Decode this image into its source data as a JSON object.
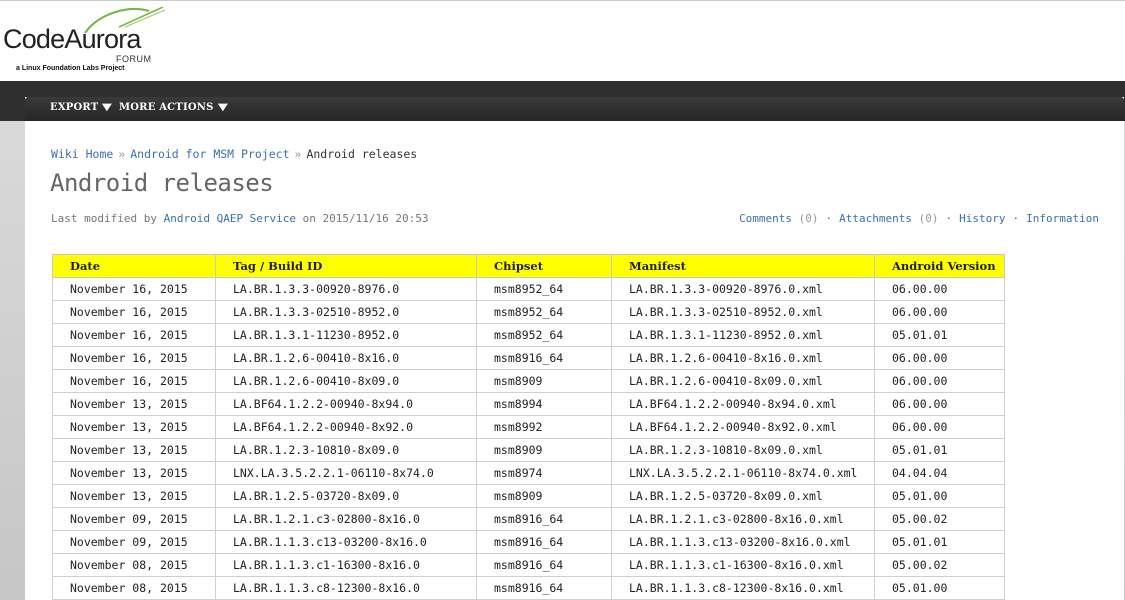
{
  "logo": {
    "code": "Code",
    "aurora": "Aurora",
    "forum": "FORUM",
    "tagline": "a Linux Foundation Labs Project"
  },
  "toolbar": {
    "export_label": "EXPORT",
    "more_actions_label": "MORE ACTIONS"
  },
  "breadcrumb": {
    "items": [
      "Wiki Home",
      "Android for MSM Project"
    ],
    "current": "Android releases"
  },
  "page": {
    "title": "Android releases",
    "modified_prefix": "Last modified by",
    "author": "Android QAEP Service",
    "modified_on": "on 2015/11/16 20:53"
  },
  "actions": {
    "comments": "Comments",
    "comments_count": "(0)",
    "attachments": "Attachments",
    "attachments_count": "(0)",
    "history": "History",
    "information": "Information"
  },
  "table": {
    "headers": [
      "Date",
      "Tag / Build ID",
      "Chipset",
      "Manifest",
      "Android Version"
    ],
    "header_color": "#ffff00",
    "rows": [
      [
        "November 16, 2015",
        "LA.BR.1.3.3-00920-8976.0",
        "msm8952_64",
        "LA.BR.1.3.3-00920-8976.0.xml",
        "06.00.00"
      ],
      [
        "November 16, 2015",
        "LA.BR.1.3.3-02510-8952.0",
        "msm8952_64",
        "LA.BR.1.3.3-02510-8952.0.xml",
        "06.00.00"
      ],
      [
        "November 16, 2015",
        "LA.BR.1.3.1-11230-8952.0",
        "msm8952_64",
        "LA.BR.1.3.1-11230-8952.0.xml",
        "05.01.01"
      ],
      [
        "November 16, 2015",
        "LA.BR.1.2.6-00410-8x16.0",
        "msm8916_64",
        "LA.BR.1.2.6-00410-8x16.0.xml",
        "06.00.00"
      ],
      [
        "November 16, 2015",
        "LA.BR.1.2.6-00410-8x09.0",
        "msm8909",
        "LA.BR.1.2.6-00410-8x09.0.xml",
        "06.00.00"
      ],
      [
        "November 13, 2015",
        "LA.BF64.1.2.2-00940-8x94.0",
        "msm8994",
        "LA.BF64.1.2.2-00940-8x94.0.xml",
        "06.00.00"
      ],
      [
        "November 13, 2015",
        "LA.BF64.1.2.2-00940-8x92.0",
        "msm8992",
        "LA.BF64.1.2.2-00940-8x92.0.xml",
        "06.00.00"
      ],
      [
        "November 13, 2015",
        "LA.BR.1.2.3-10810-8x09.0",
        "msm8909",
        "LA.BR.1.2.3-10810-8x09.0.xml",
        "05.01.01"
      ],
      [
        "November 13, 2015",
        "LNX.LA.3.5.2.2.1-06110-8x74.0",
        "msm8974",
        "LNX.LA.3.5.2.2.1-06110-8x74.0.xml",
        "04.04.04"
      ],
      [
        "November 13, 2015",
        "LA.BR.1.2.5-03720-8x09.0",
        "msm8909",
        "LA.BR.1.2.5-03720-8x09.0.xml",
        "05.01.00"
      ],
      [
        "November 09, 2015",
        "LA.BR.1.2.1.c3-02800-8x16.0",
        "msm8916_64",
        "LA.BR.1.2.1.c3-02800-8x16.0.xml",
        "05.00.02"
      ],
      [
        "November 09, 2015",
        "LA.BR.1.1.3.c13-03200-8x16.0",
        "msm8916_64",
        "LA.BR.1.1.3.c13-03200-8x16.0.xml",
        "05.01.01"
      ],
      [
        "November 08, 2015",
        "LA.BR.1.1.3.c1-16300-8x16.0",
        "msm8916_64",
        "LA.BR.1.1.3.c1-16300-8x16.0.xml",
        "05.00.02"
      ],
      [
        "November 08, 2015",
        "LA.BR.1.1.3.c8-12300-8x16.0",
        "msm8916_64",
        "LA.BR.1.1.3.c8-12300-8x16.0.xml",
        "05.01.00"
      ]
    ]
  }
}
